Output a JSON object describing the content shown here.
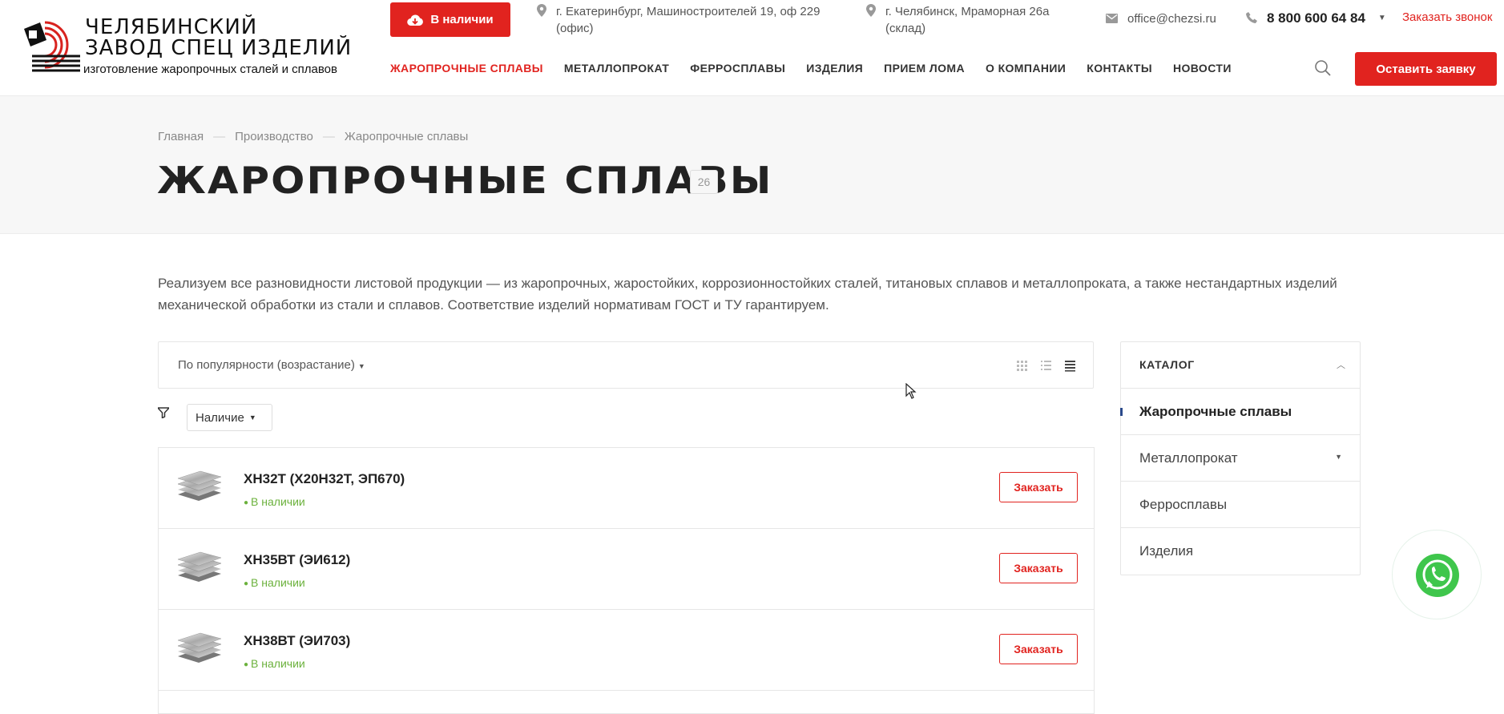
{
  "header": {
    "logo": {
      "line1": "ЧЕЛЯБИНСКИЙ",
      "line2": "ЗАВОД СПЕЦ ИЗДЕЛИЙ",
      "tagline": "изготовление жаропрочных сталей и сплавов",
      "icon": "spiral-logo-icon"
    },
    "stock_button": {
      "label": "В наличии",
      "icon": "cloud-download-icon"
    },
    "address_ekb": {
      "line1": "г. Екатеринбург,  Машиностроителей 19,  оф 229",
      "line2": "(офис)",
      "icon": "map-pin-icon"
    },
    "address_chel": {
      "line1": "г. Челябинск, Мраморная 26а",
      "line2": "(склад)",
      "icon": "map-pin-icon"
    },
    "email": {
      "value": "office@chezsi.ru",
      "icon": "mail-icon"
    },
    "phone": {
      "value": "8 800 600 64 84",
      "icon": "phone-icon"
    },
    "callback_label": "Заказать звонок",
    "nav": [
      {
        "label": "ЖАРОПРОЧНЫЕ СПЛАВЫ",
        "active": true
      },
      {
        "label": "МЕТАЛЛОПРОКАТ",
        "active": false
      },
      {
        "label": "ФЕРРОСПЛАВЫ",
        "active": false
      },
      {
        "label": "ИЗДЕЛИЯ",
        "active": false
      },
      {
        "label": "ПРИЕМ ЛОМА",
        "active": false
      },
      {
        "label": "О КОМПАНИИ",
        "active": false
      },
      {
        "label": "КОНТАКТЫ",
        "active": false
      },
      {
        "label": "НОВОСТИ",
        "active": false
      }
    ],
    "search_icon": "search-icon",
    "request_button": "Оставить заявку"
  },
  "page": {
    "breadcrumbs": [
      "Главная",
      "Производство",
      "Жаропрочные сплавы"
    ],
    "title": "ЖАРОПРОЧНЫЕ СПЛАВЫ",
    "count": "26",
    "intro": "Реализуем все разновидности листовой продукции — из жаропрочных, жаростойких, коррозионностойких сталей, титановых сплавов и металлопроката, а также нестандартных изделий механической обработки из стали и сплавов. Соответствие изделий нормативам ГОСТ и ТУ гарантируем."
  },
  "sort": {
    "selected": "По популярности (возрастание)",
    "views": [
      "grid-view-icon",
      "list-view-icon",
      "table-view-icon"
    ],
    "active_view": "table-view-icon"
  },
  "filter": {
    "icon": "filter-icon",
    "dropdown": "Наличие"
  },
  "products": [
    {
      "name": "ХН32Т (Х20Н32Т, ЭП670)",
      "stock": "В наличии",
      "order": "Заказать"
    },
    {
      "name": "ХН35ВТ (ЭИ612)",
      "stock": "В наличии",
      "order": "Заказать"
    },
    {
      "name": "ХН38ВТ (ЭИ703)",
      "stock": "В наличии",
      "order": "Заказать"
    }
  ],
  "catalog": {
    "title": "КАТАЛОГ",
    "items": [
      {
        "label": "Жаропрочные сплавы",
        "active": true,
        "has_children": false
      },
      {
        "label": "Металлопрокат",
        "active": false,
        "has_children": true
      },
      {
        "label": "Ферросплавы",
        "active": false,
        "has_children": false
      },
      {
        "label": "Изделия",
        "active": false,
        "has_children": false
      }
    ]
  },
  "whatsapp_icon": "whatsapp-icon",
  "colors": {
    "accent": "#e1231f",
    "in_stock": "#6bb13c",
    "whatsapp": "#3fc64c"
  }
}
